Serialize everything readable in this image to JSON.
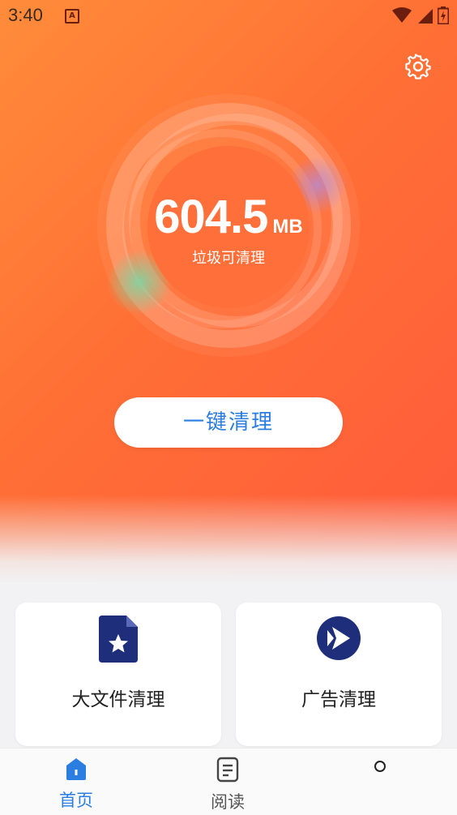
{
  "status_bar": {
    "time": "3:40",
    "notification_icon": "A",
    "icons": [
      "wifi-icon",
      "signal-icon",
      "battery-charging-icon"
    ]
  },
  "header": {
    "settings_icon": "gear-icon"
  },
  "storage": {
    "value": "604.5",
    "unit": "MB",
    "label": "垃圾可清理"
  },
  "actions": {
    "clean_button": "一键清理"
  },
  "cards": [
    {
      "label": "大文件清理",
      "icon": "file-star-icon",
      "icon_color": "#1f2e7a"
    },
    {
      "label": "广告清理",
      "icon": "ad-play-icon",
      "icon_color": "#1f2e7a"
    }
  ],
  "tabbar": {
    "tabs": [
      {
        "label": "首页",
        "icon": "home-icon",
        "active": true
      },
      {
        "label": "阅读",
        "icon": "document-icon",
        "active": false
      }
    ],
    "extra_icon": "circle-icon"
  },
  "colors": {
    "accent": "#2a7de1",
    "hero_start": "#ff8c3a",
    "hero_end": "#ff5a3c",
    "inactive_tab": "#555555"
  }
}
